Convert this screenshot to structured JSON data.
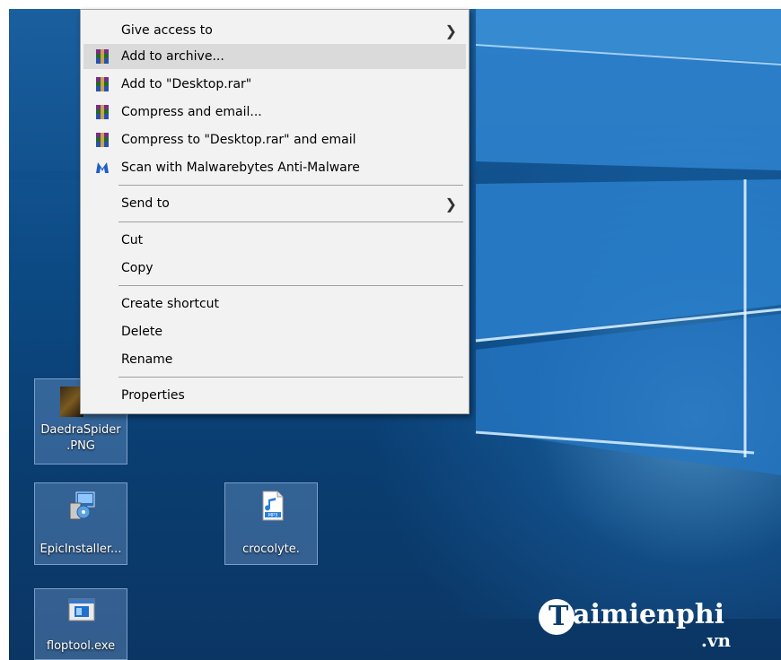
{
  "context_menu": {
    "items": [
      {
        "label": "Give access to",
        "icon": "",
        "submenu": true
      },
      {
        "label": "Add to archive...",
        "icon": "winrar-icon",
        "hover": true
      },
      {
        "label": "Add to \"Desktop.rar\"",
        "icon": "winrar-icon"
      },
      {
        "label": "Compress and email...",
        "icon": "winrar-icon"
      },
      {
        "label": "Compress to \"Desktop.rar\" and email",
        "icon": "winrar-icon"
      },
      {
        "label": "Scan with Malwarebytes Anti-Malware",
        "icon": "malwarebytes-icon"
      },
      {
        "label": "Send to",
        "icon": "",
        "submenu": true
      },
      {
        "label": "Cut",
        "icon": ""
      },
      {
        "label": "Copy",
        "icon": ""
      },
      {
        "label": "Create shortcut",
        "icon": ""
      },
      {
        "label": "Delete",
        "icon": ""
      },
      {
        "label": "Rename",
        "icon": ""
      },
      {
        "label": "Properties",
        "icon": ""
      }
    ],
    "submenu_arrow": "❯"
  },
  "desktop": {
    "icons": [
      {
        "label_line1": "DaedraSpider",
        "label_line2": ".PNG",
        "icon": "image-file-icon"
      },
      {
        "label": "EpicInstaller...",
        "icon": "installer-icon"
      },
      {
        "label": "crocolyte.",
        "icon": "mp3-file-icon"
      },
      {
        "label": "floptool.exe",
        "icon": "exe-file-icon"
      }
    ]
  },
  "watermark": {
    "logo_letter": "T",
    "brand": "aimienphi",
    "suffix": ".vn"
  },
  "colors": {
    "menu_bg": "#f2f2f2",
    "hover_bg": "#dadada",
    "desktop_blue": "#0c4a84"
  }
}
